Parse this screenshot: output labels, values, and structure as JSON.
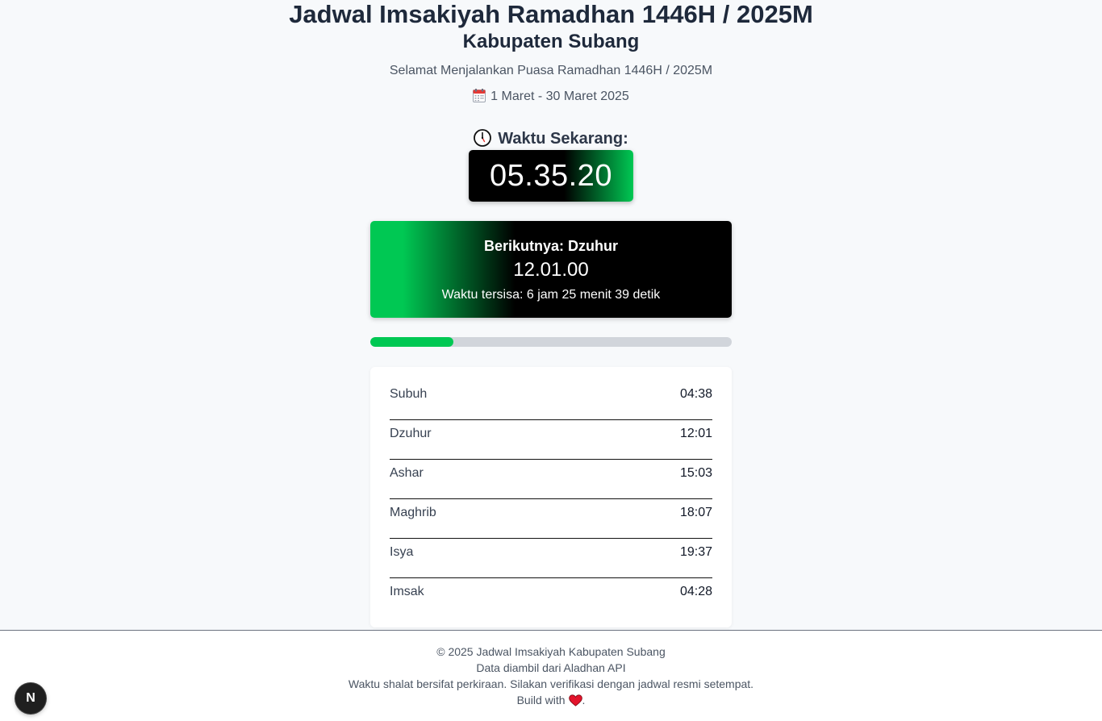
{
  "header": {
    "title": "Jadwal Imsakiyah Ramadhan 1446H / 2025M",
    "subtitle": "Kabupaten Subang",
    "greeting": "Selamat Menjalankan Puasa Ramadhan 1446H / 2025M",
    "date_range": "1 Maret - 30 Maret 2025",
    "date_icon": "calendar-icon"
  },
  "clock": {
    "label": "Waktu Sekarang:",
    "icon": "clock-icon",
    "current_time": "05.35.20"
  },
  "next_prayer": {
    "label": "Berikutnya: Dzuhur",
    "time": "12.01.00",
    "remaining": "Waktu tersisa: 6 jam 25 menit 39 detik"
  },
  "progress": {
    "fraction": 0.23,
    "color": "#00c853"
  },
  "schedule": [
    {
      "name": "Subuh",
      "time": "04:38"
    },
    {
      "name": "Dzuhur",
      "time": "12:01"
    },
    {
      "name": "Ashar",
      "time": "15:03"
    },
    {
      "name": "Maghrib",
      "time": "18:07"
    },
    {
      "name": "Isya",
      "time": "19:37"
    },
    {
      "name": "Imsak",
      "time": "04:28"
    }
  ],
  "footer": {
    "copyright": "© 2025 Jadwal Imsakiyah Kabupaten Subang",
    "source": "Data diambil dari Aladhan API",
    "disclaimer": "Waktu shalat bersifat perkiraan. Silakan verifikasi dengan jadwal resmi setempat.",
    "build_with": "Build with",
    "build_end": ".",
    "heart_icon": "heart-icon"
  },
  "dev_badge": {
    "label": "N",
    "icon": "nextjs-logo-icon"
  },
  "colors": {
    "accent_green": "#00c853",
    "text_dark": "#1e293b",
    "background": "#f7f9fb"
  }
}
